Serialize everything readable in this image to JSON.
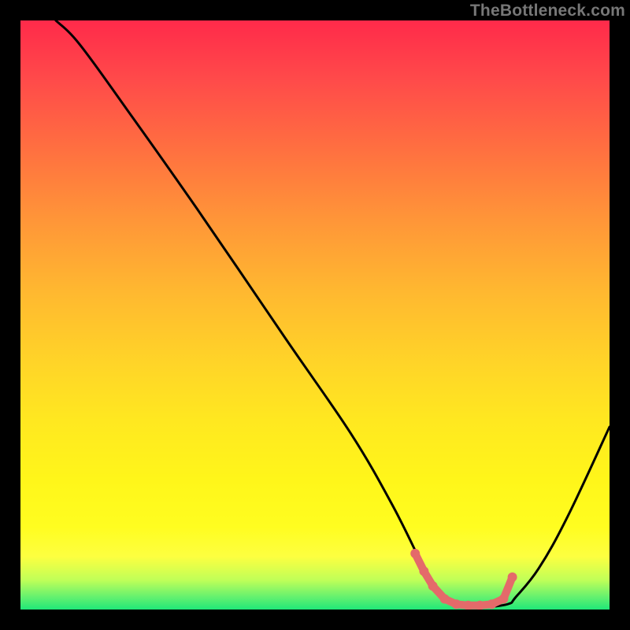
{
  "watermark": "TheBottleneck.com",
  "chart_data": {
    "type": "line",
    "title": "",
    "xlabel": "",
    "ylabel": "",
    "xlim": [
      0,
      100
    ],
    "ylim": [
      0,
      100
    ],
    "curve": {
      "name": "bottleneck-curve",
      "color": "#000000",
      "x": [
        6,
        10,
        18,
        30,
        45,
        56,
        63,
        68,
        70,
        73,
        77,
        80,
        83,
        84,
        88,
        93,
        100
      ],
      "y": [
        100,
        96,
        85,
        68,
        46,
        30,
        18,
        8,
        4,
        1,
        0.5,
        0.5,
        1,
        2,
        7,
        16,
        31
      ]
    },
    "marker_segment": {
      "name": "optimal-range",
      "color": "#e46a6a",
      "x": [
        67,
        68.5,
        70,
        72,
        74,
        76,
        78,
        80,
        82,
        83.5
      ],
      "y": [
        9.5,
        6.5,
        4,
        1.8,
        0.9,
        0.7,
        0.7,
        0.9,
        1.8,
        5.5
      ]
    },
    "gradient_stops": [
      {
        "pos": 0,
        "color": "#ff2a4a"
      },
      {
        "pos": 10,
        "color": "#ff4a4a"
      },
      {
        "pos": 22,
        "color": "#ff7040"
      },
      {
        "pos": 34,
        "color": "#ff9638"
      },
      {
        "pos": 46,
        "color": "#ffb830"
      },
      {
        "pos": 58,
        "color": "#ffd428"
      },
      {
        "pos": 68,
        "color": "#ffe820"
      },
      {
        "pos": 78,
        "color": "#fff61a"
      },
      {
        "pos": 86,
        "color": "#fffd20"
      },
      {
        "pos": 91,
        "color": "#fdff40"
      },
      {
        "pos": 95,
        "color": "#c0ff58"
      },
      {
        "pos": 98,
        "color": "#60f070"
      },
      {
        "pos": 100,
        "color": "#20e878"
      }
    ]
  }
}
